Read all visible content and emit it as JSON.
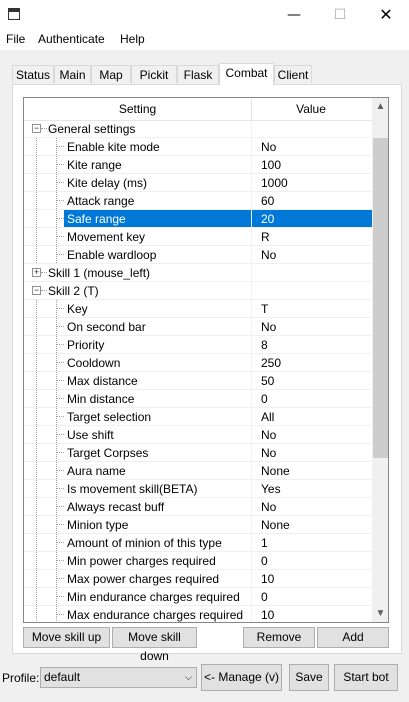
{
  "window": {
    "minimize_glyph": "—",
    "maximize_glyph": "☐",
    "close_glyph": "✕"
  },
  "menu": {
    "file": "File",
    "authenticate": "Authenticate",
    "help": "Help"
  },
  "tabs": [
    "Status",
    "Main",
    "Map",
    "Pickit",
    "Flask",
    "Combat",
    "Client"
  ],
  "active_tab": "Combat",
  "grid": {
    "col_setting": "Setting",
    "col_value": "Value",
    "rows": [
      {
        "name": "General settings",
        "value": "",
        "group": true,
        "expanded": true
      },
      {
        "name": "Enable kite mode",
        "value": "No"
      },
      {
        "name": "Kite range",
        "value": "100"
      },
      {
        "name": "Kite delay (ms)",
        "value": "1000"
      },
      {
        "name": "Attack range",
        "value": "60"
      },
      {
        "name": "Safe range",
        "value": "20",
        "selected": true
      },
      {
        "name": "Movement key",
        "value": "R"
      },
      {
        "name": "Enable wardloop",
        "value": "No"
      },
      {
        "name": "Skill 1 (mouse_left)",
        "value": "",
        "group": true,
        "expanded": false
      },
      {
        "name": "Skill 2 (T)",
        "value": "",
        "group": true,
        "expanded": true
      },
      {
        "name": "Key",
        "value": "T"
      },
      {
        "name": "On second bar",
        "value": "No"
      },
      {
        "name": "Priority",
        "value": "8"
      },
      {
        "name": "Cooldown",
        "value": "250"
      },
      {
        "name": "Max distance",
        "value": "50"
      },
      {
        "name": "Min distance",
        "value": "0"
      },
      {
        "name": "Target selection",
        "value": "All"
      },
      {
        "name": "Use shift",
        "value": "No"
      },
      {
        "name": "Target Corpses",
        "value": "No"
      },
      {
        "name": "Aura name",
        "value": "None"
      },
      {
        "name": "Is movement skill(BETA)",
        "value": "Yes"
      },
      {
        "name": "Always recast buff",
        "value": "No"
      },
      {
        "name": "Minion type",
        "value": "None"
      },
      {
        "name": "Amount of minion of this type",
        "value": "1"
      },
      {
        "name": "Min power charges required",
        "value": "0"
      },
      {
        "name": "Max power charges required",
        "value": "10"
      },
      {
        "name": "Min endurance charges required",
        "value": "0"
      },
      {
        "name": "Max endurance charges required",
        "value": "10"
      }
    ]
  },
  "buttons": {
    "move_up": "Move skill up",
    "move_down": "Move skill down",
    "remove": "Remove",
    "add": "Add",
    "manage": "<- Manage (v)",
    "save": "Save",
    "start": "Start bot"
  },
  "profile": {
    "label": "Profile:",
    "value": "default"
  },
  "scroll": {
    "up_glyph": "▲",
    "down_glyph": "▼"
  }
}
